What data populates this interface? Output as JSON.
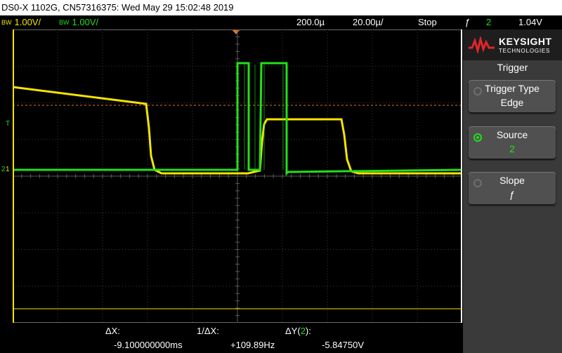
{
  "title_bar": "DS0-X 1102G, CN57316375: Wed May 29 15:02:48 2019",
  "status": {
    "ch1_bw": "BW",
    "ch1_scale": "1.00V/",
    "ch2_bw": "BW",
    "ch2_scale": "1.00V/",
    "time_delay": "200.0µ",
    "time_scale": "20.00µ/",
    "run_state": "Stop",
    "trigger_icon": "ƒ",
    "trigger_source": "2",
    "trigger_level": "1.04V"
  },
  "markers": {
    "trigger_level_marker": "T",
    "ch2_ground_marker": "2",
    "ch1_ground_marker": "1"
  },
  "logo": {
    "brand": "KEYSIGHT",
    "sub": "TECHNOLOGIES"
  },
  "menu": {
    "title": "Trigger",
    "softkeys": [
      {
        "label": "Trigger Type",
        "value": "Edge"
      },
      {
        "label": "Source",
        "value": "2"
      },
      {
        "label": "Slope",
        "value": "ƒ"
      }
    ]
  },
  "cursors": {
    "dx_label": "ΔX:",
    "dx_value": "-9.100000000ms",
    "inv_dx_label": "1/ΔX:",
    "inv_dx_value": "+109.89Hz",
    "dy_label_prefix": "ΔY(",
    "dy_channel": "2",
    "dy_label_suffix": "):",
    "dy_value": "-5.84750V"
  },
  "colors": {
    "ch1": "#f5e400",
    "ch2": "#22e01a",
    "trigger_level_line": "#e8761a",
    "grid": "#3d3d3d"
  }
}
